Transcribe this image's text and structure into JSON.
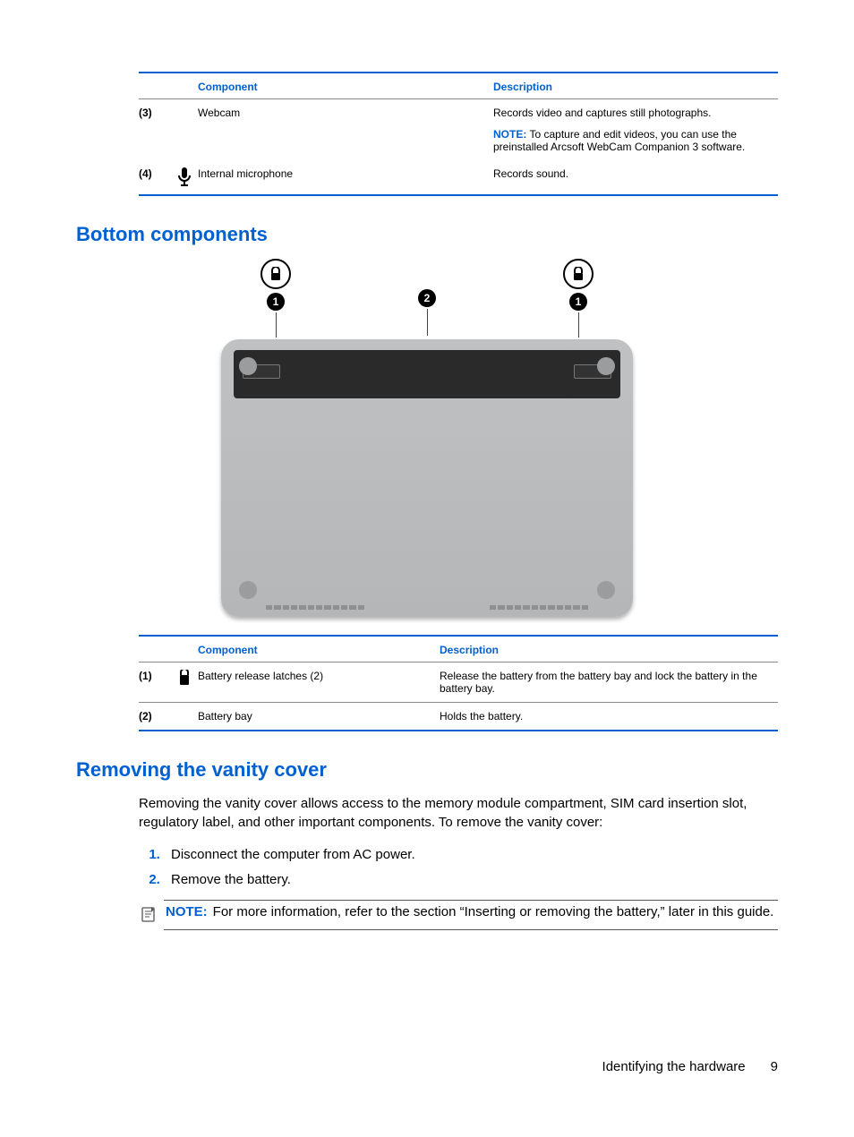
{
  "table1": {
    "headers": {
      "component": "Component",
      "description": "Description"
    },
    "rows": [
      {
        "num": "(3)",
        "name": "Webcam",
        "desc": "Records video and captures still photographs.",
        "noteLabel": "NOTE:",
        "noteText": "To capture and edit videos, you can use the preinstalled Arcsoft WebCam Companion 3 software."
      },
      {
        "num": "(4)",
        "name": "Internal microphone",
        "desc": "Records sound."
      }
    ]
  },
  "heading1": "Bottom components",
  "table2": {
    "headers": {
      "component": "Component",
      "description": "Description"
    },
    "rows": [
      {
        "num": "(1)",
        "name": "Battery release latches (2)",
        "desc": "Release the battery from the battery bay and lock the battery in the battery bay."
      },
      {
        "num": "(2)",
        "name": "Battery bay",
        "desc": "Holds the battery."
      }
    ]
  },
  "heading2": "Removing the vanity cover",
  "intro": "Removing the vanity cover allows access to the memory module compartment, SIM card insertion slot, regulatory label, and other important components. To remove the vanity cover:",
  "steps": [
    "Disconnect the computer from AC power.",
    "Remove the battery."
  ],
  "note": {
    "label": "NOTE:",
    "text": "For more information, refer to the section “Inserting or removing the battery,” later in this guide."
  },
  "footer": {
    "section": "Identifying the hardware",
    "page": "9"
  },
  "callouts": {
    "left": "1",
    "center": "2",
    "right": "1"
  }
}
